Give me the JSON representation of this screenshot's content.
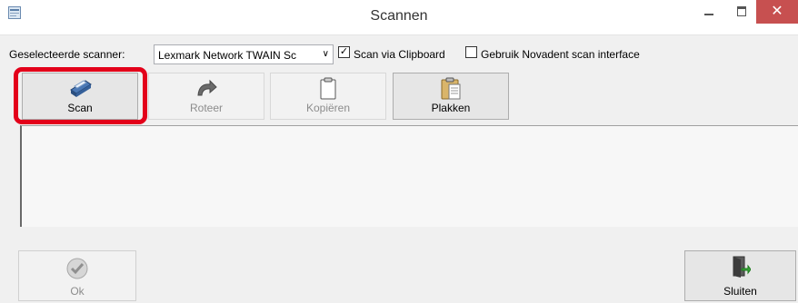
{
  "window": {
    "title": "Scannen",
    "close_glyph": "✕",
    "icons": {
      "app": "scanner-app-icon",
      "minimize": "minimize-icon",
      "maximize": "maximize-icon",
      "close": "close-icon"
    }
  },
  "scanner": {
    "label": "Geselecteerde scanner:",
    "selected": "Lexmark Network TWAIN Sc",
    "scan_via_clipboard": {
      "label": "Scan via Clipboard",
      "checked": true,
      "mark": "✓"
    },
    "novadent_interface": {
      "label": "Gebruik Novadent scan interface",
      "checked": false
    }
  },
  "toolbar": {
    "scan": {
      "label": "Scan",
      "icon": "scanner-icon",
      "enabled": true
    },
    "roteer": {
      "label": "Roteer",
      "icon": "rotate-icon",
      "enabled": false
    },
    "kopieren": {
      "label": "Kopiëren",
      "icon": "clipboard-icon",
      "enabled": false
    },
    "plakken": {
      "label": "Plakken",
      "icon": "paste-icon",
      "enabled": true
    }
  },
  "footer": {
    "ok": {
      "label": "Ok",
      "icon": "checkmark-icon",
      "enabled": false
    },
    "sluiten": {
      "label": "Sluiten",
      "icon": "exit-door-icon",
      "enabled": true
    }
  },
  "colors": {
    "highlight": "#e3001a",
    "close_button": "#c75050",
    "window_bg": "#f0f0f0"
  }
}
